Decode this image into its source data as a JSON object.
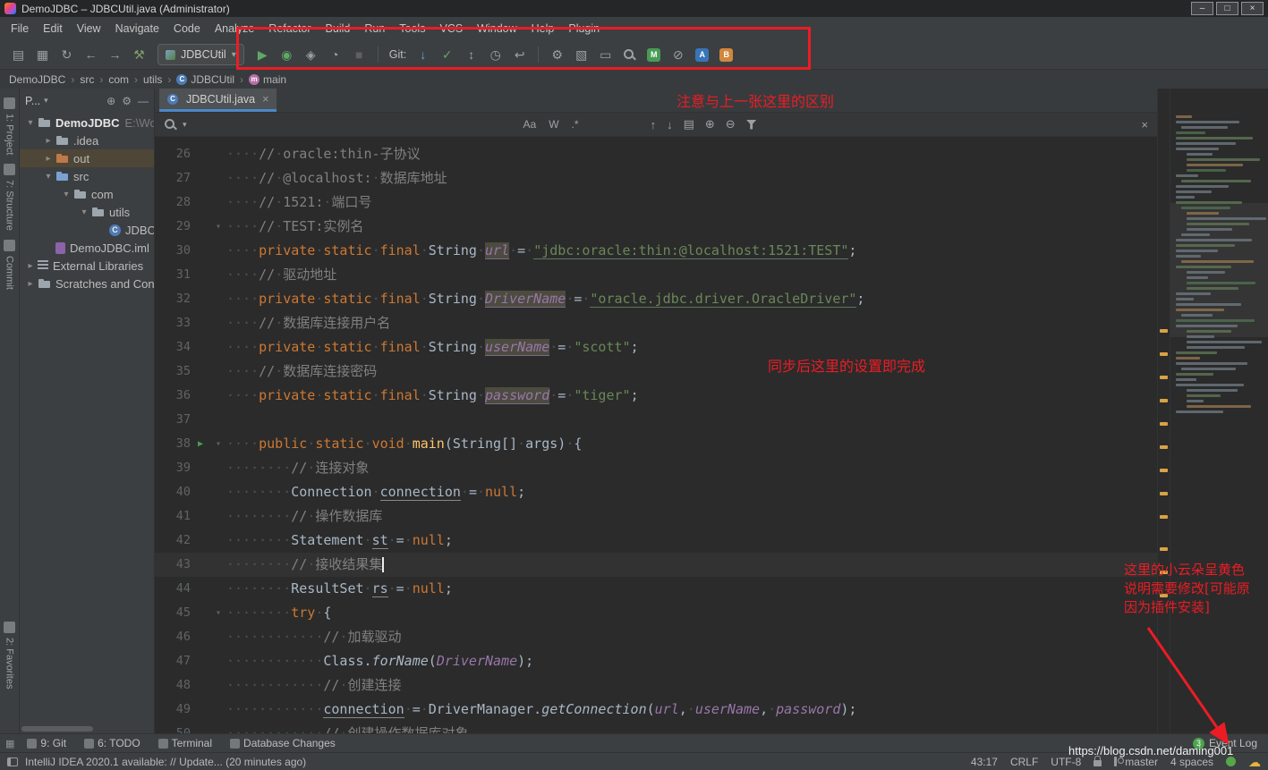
{
  "colors": {
    "annotation_red": "#ec1c24",
    "keyword_orange": "#cc7832",
    "string_green": "#6a8759",
    "comment_gray": "#808080",
    "field_purple": "#9876aa",
    "run_green": "#499C54",
    "tab_underline_blue": "#4a88c7",
    "change_marker_yellow": "#d9a343"
  },
  "titlebar": {
    "title": "DemoJDBC – JDBCUtil.java (Administrator)",
    "minimize": "–",
    "maximize": "□",
    "close": "×"
  },
  "menubar": {
    "items": [
      "File",
      "Edit",
      "View",
      "Navigate",
      "Code",
      "Analyze",
      "Refactor",
      "Build",
      "Run",
      "Tools",
      "VCS",
      "Window",
      "Help",
      "Plugin"
    ]
  },
  "toolbar": {
    "run_config": "JDBCUtil",
    "git_label": "Git:"
  },
  "breadcrumbs": {
    "separator": "›",
    "items": [
      {
        "label": "DemoJDBC"
      },
      {
        "label": "src"
      },
      {
        "label": "com"
      },
      {
        "label": "utils"
      },
      {
        "label": "JDBCUtil",
        "icon": "class"
      },
      {
        "label": "main",
        "icon": "method"
      }
    ]
  },
  "activity_bar": {
    "top": [
      "1: Project",
      "7: Structure",
      "Commit"
    ],
    "bottom": [
      "2: Favorites"
    ]
  },
  "project": {
    "header_label": "P...",
    "tree": [
      {
        "label": "DemoJDBC",
        "extra": "E:\\Wor",
        "icon": "folder-root",
        "arrow": "expanded",
        "indent": 0,
        "bold": true
      },
      {
        "label": ".idea",
        "icon": "folder",
        "arrow": "collapsed",
        "indent": 1
      },
      {
        "label": "out",
        "icon": "folder-excluded",
        "arrow": "collapsed",
        "indent": 1,
        "selected": true
      },
      {
        "label": "src",
        "icon": "folder-src",
        "arrow": "expanded",
        "indent": 1
      },
      {
        "label": "com",
        "icon": "package",
        "arrow": "expanded",
        "indent": 2
      },
      {
        "label": "utils",
        "icon": "package",
        "arrow": "expanded",
        "indent": 3
      },
      {
        "label": "JDBCUtil",
        "icon": "class",
        "indent": 4
      },
      {
        "label": "DemoJDBC.iml",
        "icon": "file-iml",
        "indent": 1
      },
      {
        "label": "External Libraries",
        "icon": "library",
        "arrow": "collapsed",
        "indent": 0
      },
      {
        "label": "Scratches and Consoles",
        "icon": "scratches",
        "arrow": "collapsed",
        "indent": 0
      }
    ]
  },
  "find": {
    "match_case": "Aa",
    "words": "W",
    "regex": ".*"
  },
  "editor": {
    "tab_label": "JDBCUtil.java",
    "tab_close": "×",
    "lines": [
      {
        "n": 26,
        "t": [
          [
            "ws",
            "    "
          ],
          [
            "cm",
            "// oracle:thin-子协议"
          ]
        ]
      },
      {
        "n": 27,
        "t": [
          [
            "ws",
            "    "
          ],
          [
            "cm",
            "// @localhost: 数据库地址"
          ]
        ]
      },
      {
        "n": 28,
        "t": [
          [
            "ws",
            "    "
          ],
          [
            "cm",
            "// 1521: 端口号"
          ]
        ]
      },
      {
        "n": 29,
        "fold": true,
        "t": [
          [
            "ws",
            "    "
          ],
          [
            "cm",
            "// TEST:实例名"
          ]
        ]
      },
      {
        "n": 30,
        "t": [
          [
            "ws",
            "    "
          ],
          [
            "kw",
            "private static final "
          ],
          [
            "pl",
            "String "
          ],
          [
            "fb",
            "url"
          ],
          [
            "pl",
            " = "
          ],
          [
            "su",
            "\"jdbc:oracle:thin:@localhost:1521:TEST\""
          ],
          [
            "pl",
            ";"
          ]
        ]
      },
      {
        "n": 31,
        "t": [
          [
            "ws",
            "    "
          ],
          [
            "cm",
            "// 驱动地址"
          ]
        ]
      },
      {
        "n": 32,
        "t": [
          [
            "ws",
            "    "
          ],
          [
            "kw",
            "private static final "
          ],
          [
            "pl",
            "String "
          ],
          [
            "fb",
            "DriverName"
          ],
          [
            "pl",
            " = "
          ],
          [
            "su",
            "\"oracle.jdbc.driver.OracleDriver\""
          ],
          [
            "pl",
            ";"
          ]
        ]
      },
      {
        "n": 33,
        "t": [
          [
            "ws",
            "    "
          ],
          [
            "cm",
            "// 数据库连接用户名"
          ]
        ]
      },
      {
        "n": 34,
        "t": [
          [
            "ws",
            "    "
          ],
          [
            "kw",
            "private static final "
          ],
          [
            "pl",
            "String "
          ],
          [
            "fb",
            "userName"
          ],
          [
            "pl",
            " = "
          ],
          [
            "st",
            "\"scott\""
          ],
          [
            "pl",
            ";"
          ]
        ]
      },
      {
        "n": 35,
        "t": [
          [
            "ws",
            "    "
          ],
          [
            "cm",
            "// 数据库连接密码"
          ]
        ]
      },
      {
        "n": 36,
        "t": [
          [
            "ws",
            "    "
          ],
          [
            "kw",
            "private static final "
          ],
          [
            "pl",
            "String "
          ],
          [
            "fb",
            "password"
          ],
          [
            "pl",
            " = "
          ],
          [
            "st",
            "\"tiger\""
          ],
          [
            "pl",
            ";"
          ]
        ]
      },
      {
        "n": 37,
        "t": []
      },
      {
        "n": 38,
        "run": true,
        "fold": true,
        "t": [
          [
            "ws",
            "    "
          ],
          [
            "kw",
            "public static void "
          ],
          [
            "md",
            "main"
          ],
          [
            "pl",
            "(String[] args) {"
          ]
        ]
      },
      {
        "n": 39,
        "t": [
          [
            "ws",
            "        "
          ],
          [
            "cm",
            "// 连接对象"
          ]
        ]
      },
      {
        "n": 40,
        "t": [
          [
            "ws",
            "        "
          ],
          [
            "pl",
            "Connection "
          ],
          [
            "rv",
            "connection"
          ],
          [
            "pl",
            " = "
          ],
          [
            "kw",
            "null"
          ],
          [
            "pl",
            ";"
          ]
        ]
      },
      {
        "n": 41,
        "t": [
          [
            "ws",
            "        "
          ],
          [
            "cm",
            "// 操作数据库"
          ]
        ]
      },
      {
        "n": 42,
        "t": [
          [
            "ws",
            "        "
          ],
          [
            "pl",
            "Statement "
          ],
          [
            "rv",
            "st"
          ],
          [
            "pl",
            " = "
          ],
          [
            "kw",
            "null"
          ],
          [
            "pl",
            ";"
          ]
        ]
      },
      {
        "n": 43,
        "caretline": true,
        "t": [
          [
            "ws",
            "        "
          ],
          [
            "cm",
            "// 接收结果集"
          ],
          [
            "cr",
            ""
          ]
        ]
      },
      {
        "n": 44,
        "t": [
          [
            "ws",
            "        "
          ],
          [
            "pl",
            "ResultSet "
          ],
          [
            "rv",
            "rs"
          ],
          [
            "pl",
            " = "
          ],
          [
            "kw",
            "null"
          ],
          [
            "pl",
            ";"
          ]
        ]
      },
      {
        "n": 45,
        "fold": true,
        "t": [
          [
            "ws",
            "        "
          ],
          [
            "kw",
            "try "
          ],
          [
            "pl",
            "{"
          ]
        ]
      },
      {
        "n": 46,
        "t": [
          [
            "ws",
            "            "
          ],
          [
            "cm",
            "// 加载驱动"
          ]
        ]
      },
      {
        "n": 47,
        "t": [
          [
            "ws",
            "            "
          ],
          [
            "pl",
            "Class."
          ],
          [
            "sm",
            "forName"
          ],
          [
            "pl",
            "("
          ],
          [
            "fd",
            "DriverName"
          ],
          [
            "pl",
            ");"
          ]
        ]
      },
      {
        "n": 48,
        "t": [
          [
            "ws",
            "            "
          ],
          [
            "cm",
            "// 创建连接"
          ]
        ]
      },
      {
        "n": 49,
        "t": [
          [
            "ws",
            "            "
          ],
          [
            "rv",
            "connection"
          ],
          [
            "pl",
            " = DriverManager."
          ],
          [
            "sm",
            "getConnection"
          ],
          [
            "pl",
            "("
          ],
          [
            "fd",
            "url"
          ],
          [
            "pl",
            ", "
          ],
          [
            "fd",
            "userName"
          ],
          [
            "pl",
            ", "
          ],
          [
            "fd",
            "password"
          ],
          [
            "pl",
            ");"
          ]
        ]
      },
      {
        "n": 50,
        "t": [
          [
            "ws",
            "            "
          ],
          [
            "cm",
            "// 创建操作数据库对象"
          ]
        ]
      }
    ]
  },
  "bottom_bar": {
    "tabs": [
      {
        "label": "9: Git"
      },
      {
        "label": "6: TODO"
      },
      {
        "label": "Terminal"
      },
      {
        "label": "Database Changes"
      }
    ],
    "event_log": {
      "label": "Event Log",
      "badge": "3"
    }
  },
  "status_bar": {
    "message": "IntelliJ IDEA 2020.1 available: // Update... (20 minutes ago)",
    "position": "43:17",
    "line_separator": "CRLF",
    "encoding": "UTF-8",
    "branch": "master",
    "indent": "4 spaces"
  },
  "watermark": {
    "text": "https://blog.csdn.net/daming001"
  },
  "annotations": {
    "toolbar_note": "注意与上一张这里的区别",
    "settings_note": "同步后这里的设置即完成",
    "cloud_note": "这里的小云朵呈黄色\n说明需要修改[可能原\n因为插件安装]"
  }
}
